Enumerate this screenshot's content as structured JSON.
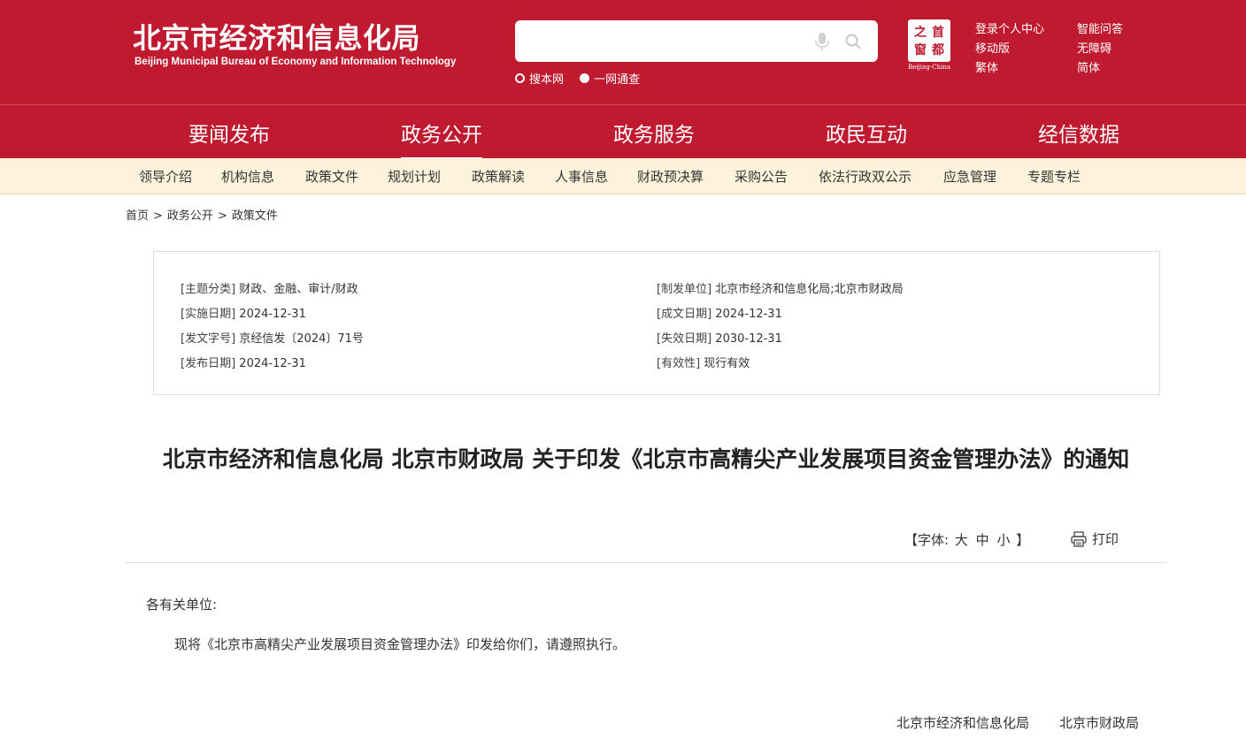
{
  "header": {
    "title_cn": "北京市经济和信息化局",
    "title_en": "Beijing Municipal Bureau of Economy and Information Technology",
    "search": {
      "value": "",
      "placeholder": ""
    },
    "search_scope": [
      "搜本网",
      "一网通查"
    ],
    "seal": {
      "chars": [
        "首",
        "之",
        "都",
        "窗"
      ],
      "caption": "Beijing-China"
    },
    "links": [
      "登录个人中心",
      "智能问答",
      "移动版",
      "无障碍",
      "繁体",
      "简体"
    ]
  },
  "main_nav": [
    "要闻发布",
    "政务公开",
    "政务服务",
    "政民互动",
    "经信数据"
  ],
  "main_nav_active": "政务公开",
  "sub_nav": [
    "领导介绍",
    "机构信息",
    "政策文件",
    "规划计划",
    "政策解读",
    "人事信息",
    "财政预决算",
    "采购公告",
    "依法行政双公示",
    "应急管理",
    "专题专栏"
  ],
  "breadcrumb": [
    "首页",
    "政务公开",
    "政策文件"
  ],
  "breadcrumb_sep": ">",
  "meta": {
    "topic": {
      "label": "[主题分类]",
      "value": "财政、金融、审计/财政"
    },
    "issuer": {
      "label": "[制发单位]",
      "value": "北京市经济和信息化局;北京市财政局"
    },
    "effective_date": {
      "label": "[实施日期]",
      "value": "2024-12-31"
    },
    "written_date": {
      "label": "[成文日期]",
      "value": "2024-12-31"
    },
    "doc_number": {
      "label": "[发文字号]",
      "value": "京经信发〔2024〕71号"
    },
    "expiry_date": {
      "label": "[失效日期]",
      "value": "2030-12-31"
    },
    "publish_date": {
      "label": "[发布日期]",
      "value": "2024-12-31"
    },
    "validity": {
      "label": "[有效性]",
      "value": "现行有效"
    }
  },
  "doc": {
    "title": "北京市经济和信息化局 北京市财政局 关于印发《北京市高精尖产业发展项目资金管理办法》的通知",
    "font_label_open": "【字体:",
    "font_sizes": [
      "大",
      "中",
      "小"
    ],
    "font_label_close": "】",
    "print_label": "打印",
    "salutation": "各有关单位:",
    "paragraph": "现将《北京市高精尖产业发展项目资金管理办法》印发给你们，请遵照执行。",
    "signers": [
      "北京市经济和信息化局",
      "北京市财政局"
    ]
  },
  "colors": {
    "brand_red": "#bf1a2f",
    "subnav_bg": "#fdf3dc"
  }
}
